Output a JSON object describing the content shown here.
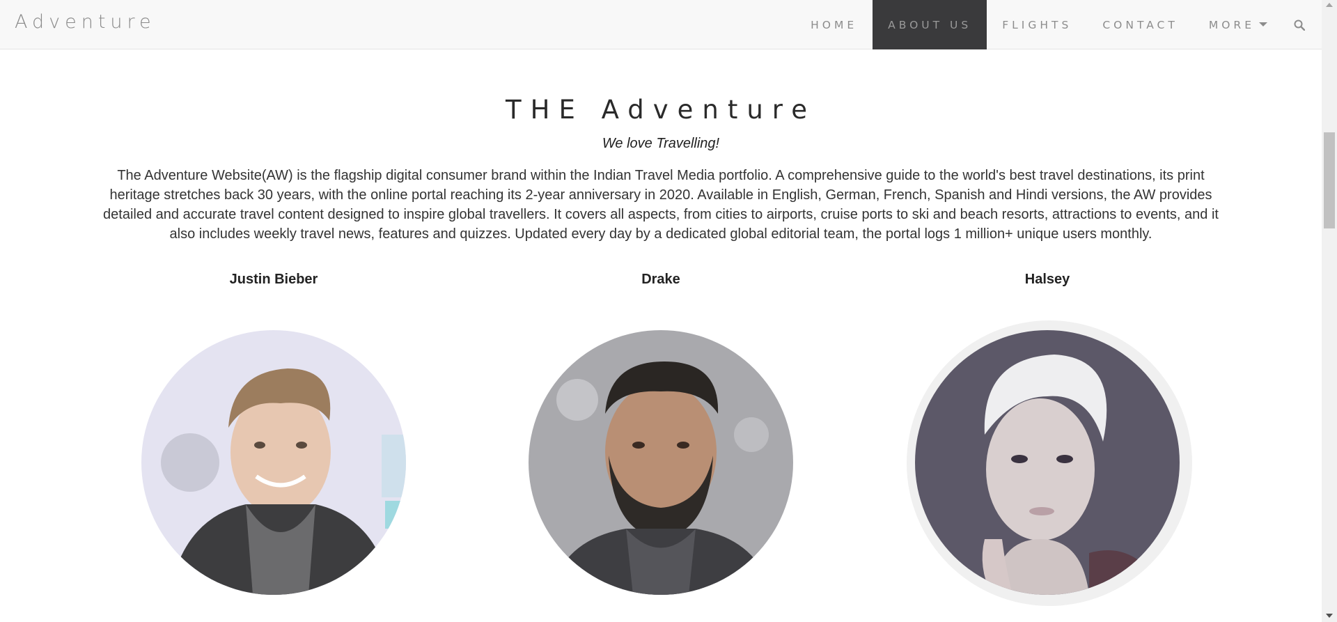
{
  "navbar": {
    "brand": "Adventure",
    "items": [
      {
        "label": "HOME"
      },
      {
        "label": "ABOUT US"
      },
      {
        "label": "FLIGHTS"
      },
      {
        "label": "CONTACT"
      },
      {
        "label": "MORE"
      }
    ],
    "search_icon": "search-icon"
  },
  "main": {
    "title": "THE Adventure",
    "subtitle": "We love Travelling!",
    "description": "The Adventure Website(AW) is the flagship digital consumer brand within the Indian Travel Media portfolio. A comprehensive guide to the world's best travel destinations, its print heritage stretches back 30 years, with the online portal reaching its 2-year anniversary in 2020. Available in English, German, French, Spanish and Hindi versions, the AW provides detailed and accurate travel content designed to inspire global travellers. It covers all aspects, from cities to airports, cruise ports to ski and beach resorts, attractions to events, and it also includes weekly travel news, features and quizzes. Updated every day by a dedicated global editorial team, the portal logs 1 million+ unique users monthly."
  },
  "team": [
    {
      "name": "Justin Bieber"
    },
    {
      "name": "Drake"
    },
    {
      "name": "Halsey"
    }
  ],
  "colors": {
    "navbar_bg": "#f8f8f8",
    "nav_active_bg": "#3a3a3c",
    "nav_text": "#8c8c8c"
  }
}
